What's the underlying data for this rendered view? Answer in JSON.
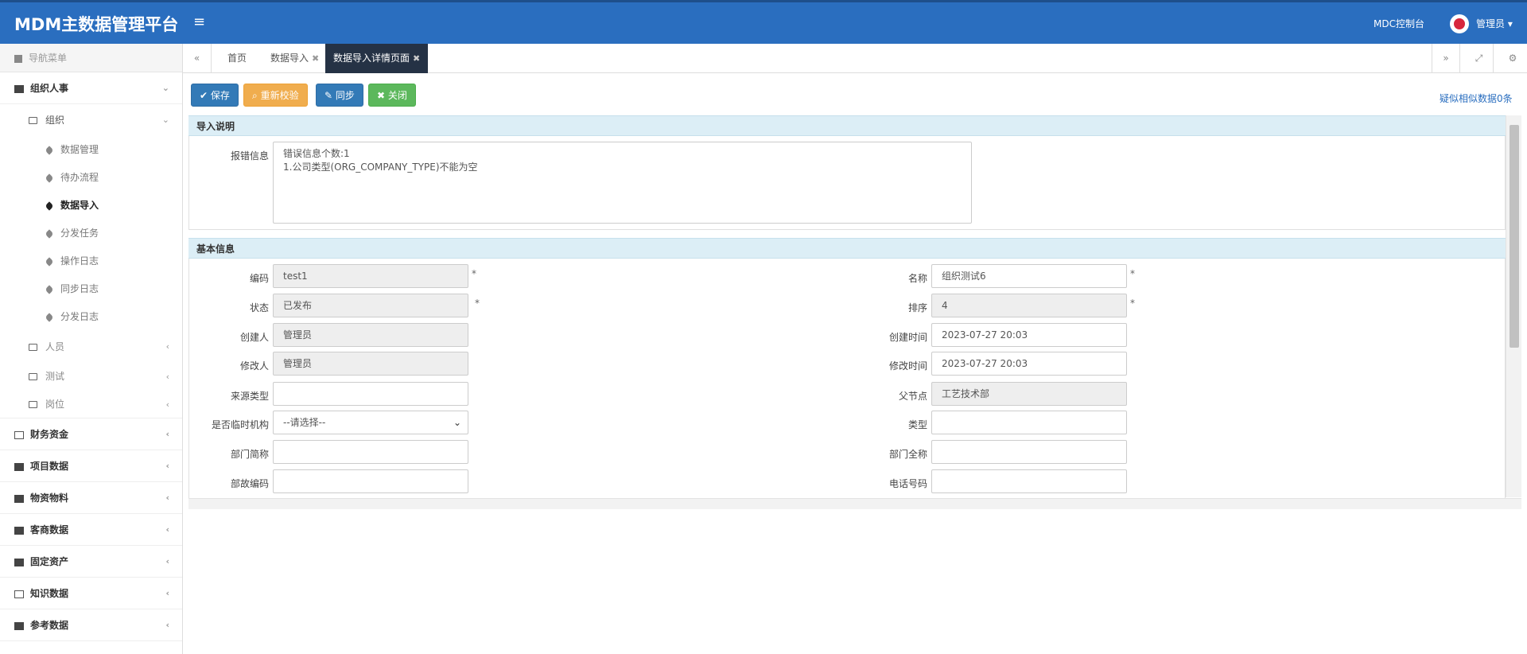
{
  "header": {
    "brand": "MDM主数据管理平台",
    "menu_icon": "hamburger-icon",
    "console_link": "MDC控制台",
    "user_name": "管理员 ▾",
    "accent_color": "#2a6ebf"
  },
  "sidebar": {
    "title": "导航菜单",
    "groups": [
      {
        "label": "组织人事"
      },
      {
        "label": "财务资金"
      },
      {
        "label": "项目数据"
      },
      {
        "label": "物资物料"
      },
      {
        "label": "客商数据"
      },
      {
        "label": "固定资产"
      },
      {
        "label": "知识数据"
      },
      {
        "label": "参考数据"
      }
    ],
    "subgroups": [
      {
        "label": "组织"
      },
      {
        "label": "人员"
      },
      {
        "label": "测试"
      },
      {
        "label": "岗位"
      }
    ],
    "leaves": [
      {
        "label": "数据管理"
      },
      {
        "label": "待办流程"
      },
      {
        "label": "数据导入"
      },
      {
        "label": "分发任务"
      },
      {
        "label": "操作日志"
      },
      {
        "label": "同步日志"
      },
      {
        "label": "分发日志"
      }
    ]
  },
  "tabs": [
    {
      "label": "首页"
    },
    {
      "label": "数据导入"
    },
    {
      "label": "数据导入详情页面"
    }
  ],
  "toolbar": {
    "save": "保存",
    "recheck": "重新校验",
    "sync": "同步",
    "close": "关闭",
    "similar": "疑似相似数据0条"
  },
  "import_panel": {
    "title": "导入说明",
    "error_label": "报错信息",
    "error_lines": [
      "错误信息个数:1",
      "1.公司类型(ORG_COMPANY_TYPE)不能为空"
    ]
  },
  "basic_panel": {
    "title": "基本信息",
    "left": [
      {
        "label": "编码",
        "value": "test1",
        "readonly": true,
        "required": true
      },
      {
        "label": "状态",
        "value": "已发布",
        "readonly": true,
        "required": true
      },
      {
        "label": "创建人",
        "value": "管理员",
        "readonly": true,
        "required": false
      },
      {
        "label": "修改人",
        "value": "管理员",
        "readonly": true,
        "required": false
      },
      {
        "label": "来源类型",
        "value": "",
        "readonly": false,
        "required": false
      },
      {
        "label": "是否临时机构",
        "value": "--请选择--",
        "readonly": false,
        "required": false
      },
      {
        "label": "部门简称",
        "value": "",
        "readonly": false,
        "required": false
      },
      {
        "label": "部故编码",
        "value": "",
        "readonly": false,
        "required": false
      }
    ],
    "right": [
      {
        "label": "名称",
        "value": "组织测试6",
        "readonly": false,
        "required": true
      },
      {
        "label": "排序",
        "value": "4",
        "readonly": true,
        "required": true
      },
      {
        "label": "创建时间",
        "value": "2023-07-27 20:03",
        "readonly": false,
        "required": false
      },
      {
        "label": "修改时间",
        "value": "2023-07-27 20:03",
        "readonly": false,
        "required": false
      },
      {
        "label": "父节点",
        "value": "工艺技术部",
        "readonly": true,
        "required": false
      },
      {
        "label": "类型",
        "value": "",
        "readonly": false,
        "required": false
      },
      {
        "label": "部门全称",
        "value": "",
        "readonly": false,
        "required": false
      },
      {
        "label": "电话号码",
        "value": "",
        "readonly": false,
        "required": false
      }
    ]
  }
}
